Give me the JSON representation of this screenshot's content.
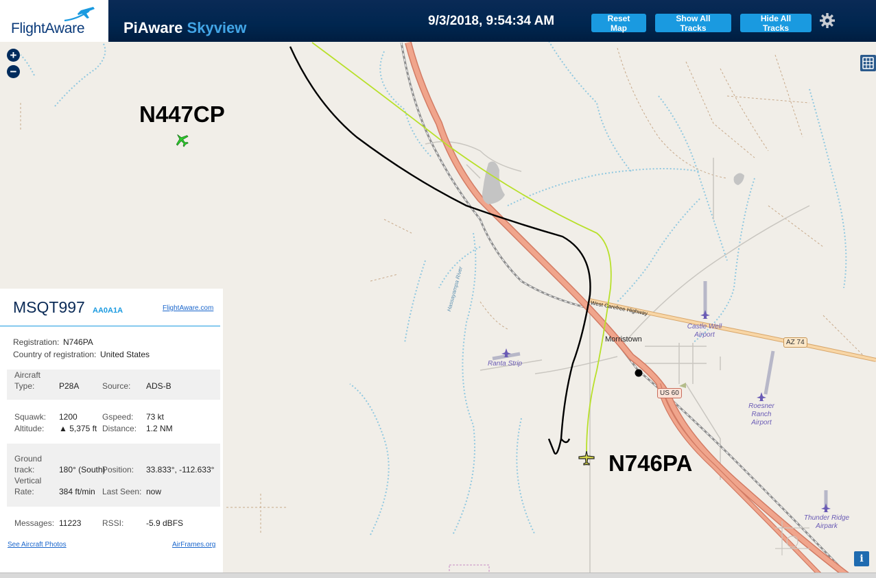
{
  "header": {
    "logo_text": "FlightAware",
    "app_name_primary": "PiAware",
    "app_name_accent": "Skyview",
    "timestamp": "9/3/2018, 9:54:34 AM",
    "buttons": {
      "reset_map": "Reset Map",
      "show_all_tracks": "Show All Tracks",
      "hide_all_tracks": "Hide All Tracks"
    },
    "settings_icon": "gear-icon"
  },
  "map": {
    "zoom_in": "+",
    "zoom_out": "−",
    "layers_icon": "grid-icon",
    "info_icon": "i",
    "aircraft": [
      {
        "registration": "N447CP",
        "color": "#2ecc2e"
      },
      {
        "registration": "N746PA",
        "color": "#d6d64a"
      }
    ],
    "places": {
      "town": "Morristown",
      "highway": "West Carefree Highway",
      "river": "Hassayampa River",
      "shield_az74": "AZ 74",
      "shield_us60": "US 60"
    },
    "airports": {
      "castle_well": "Castle Well Airport",
      "ranta": "Ranta Strip",
      "roesner": "Roesner Ranch Airport",
      "thunder_ridge": "Thunder Ridge Airpark"
    },
    "colors": {
      "track_black": "#000000",
      "track_lime": "#b8e02a",
      "highway_fill": "#f0a58c",
      "state_route": "#f5c98a",
      "water": "#8fc8e0"
    }
  },
  "info_panel": {
    "callsign": "MSQT997",
    "hex": "AA0A1A",
    "flightaware_link": "FlightAware.com",
    "registration_label": "Registration:",
    "registration": "N746PA",
    "country_label": "Country of registration:",
    "country": "United States",
    "aircraft_type_label_1": "Aircraft",
    "aircraft_type_label_2": "Type:",
    "aircraft_type": "P28A",
    "source_label": "Source:",
    "source": "ADS-B",
    "squawk_label": "Squawk:",
    "squawk": "1200",
    "gspeed_label": "Gspeed:",
    "gspeed": "73 kt",
    "altitude_label": "Altitude:",
    "altitude": "▲ 5,375 ft",
    "distance_label": "Distance:",
    "distance": "1.2 NM",
    "ground_track_label_1": "Ground",
    "ground_track_label_2": "track:",
    "ground_track": "180° (South)",
    "position_label": "Position:",
    "position": "33.833°, -112.633°",
    "vertical_rate_label_1": "Vertical",
    "vertical_rate_label_2": "Rate:",
    "vertical_rate": "384 ft/min",
    "last_seen_label": "Last Seen:",
    "last_seen": "now",
    "messages_label": "Messages:",
    "messages": "11223",
    "rssi_label": "RSSI:",
    "rssi": "-5.9 dBFS",
    "photos_link": "See Aircraft Photos",
    "airframes_link": "AirFrames.org"
  }
}
